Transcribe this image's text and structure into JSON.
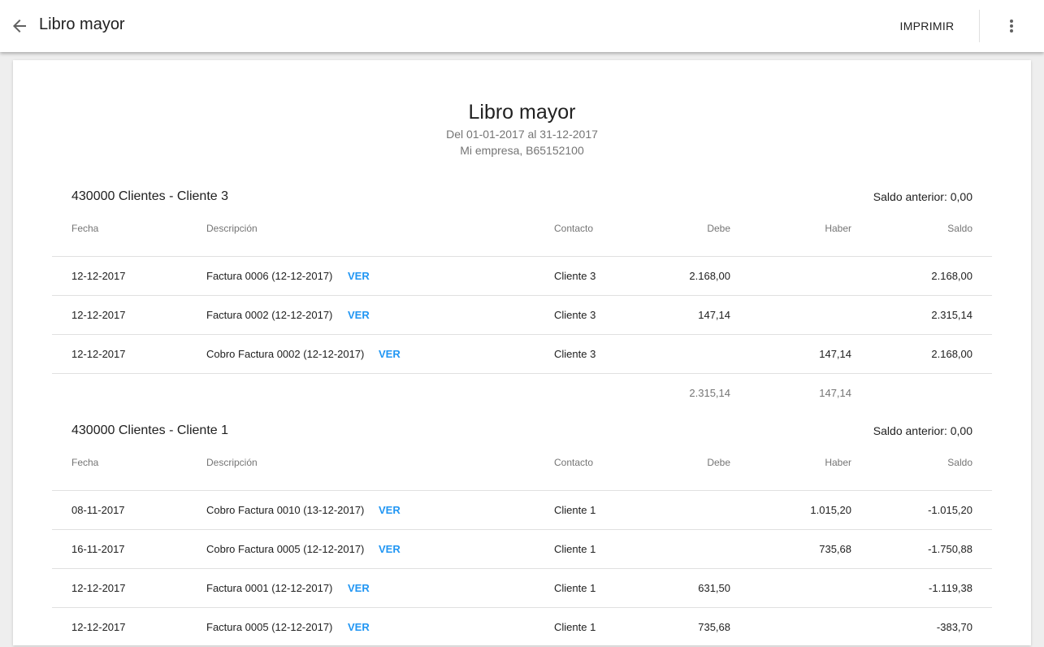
{
  "header": {
    "title": "Libro mayor",
    "print_label": "IMPRIMIR"
  },
  "report": {
    "title": "Libro mayor",
    "period": "Del 01-01-2017 al 31-12-2017",
    "company": "Mi empresa, B65152100"
  },
  "columns": {
    "fecha": "Fecha",
    "descripcion": "Descripción",
    "contacto": "Contacto",
    "debe": "Debe",
    "haber": "Haber",
    "saldo": "Saldo"
  },
  "sections": [
    {
      "account": "430000 Clientes - Cliente 3",
      "saldo_anterior": "Saldo anterior: 0,00",
      "rows": [
        {
          "fecha": "12-12-2017",
          "descripcion": "Factura 0006 (12-12-2017)",
          "link": "VER",
          "contacto": "Cliente 3",
          "debe": "2.168,00",
          "haber": "",
          "saldo": "2.168,00"
        },
        {
          "fecha": "12-12-2017",
          "descripcion": "Factura 0002 (12-12-2017)",
          "link": "VER",
          "contacto": "Cliente 3",
          "debe": "147,14",
          "haber": "",
          "saldo": "2.315,14"
        },
        {
          "fecha": "12-12-2017",
          "descripcion": "Cobro Factura 0002 (12-12-2017)",
          "link": "VER",
          "contacto": "Cliente 3",
          "debe": "",
          "haber": "147,14",
          "saldo": "2.168,00"
        }
      ],
      "totals": {
        "debe": "2.315,14",
        "haber": "147,14"
      }
    },
    {
      "account": "430000 Clientes - Cliente 1",
      "saldo_anterior": "Saldo anterior: 0,00",
      "rows": [
        {
          "fecha": "08-11-2017",
          "descripcion": "Cobro Factura 0010 (13-12-2017)",
          "link": "VER",
          "contacto": "Cliente 1",
          "debe": "",
          "haber": "1.015,20",
          "saldo": "-1.015,20"
        },
        {
          "fecha": "16-11-2017",
          "descripcion": "Cobro Factura 0005 (12-12-2017)",
          "link": "VER",
          "contacto": "Cliente 1",
          "debe": "",
          "haber": "735,68",
          "saldo": "-1.750,88"
        },
        {
          "fecha": "12-12-2017",
          "descripcion": "Factura 0001 (12-12-2017)",
          "link": "VER",
          "contacto": "Cliente 1",
          "debe": "631,50",
          "haber": "",
          "saldo": "-1.119,38"
        },
        {
          "fecha": "12-12-2017",
          "descripcion": "Factura 0005 (12-12-2017)",
          "link": "VER",
          "contacto": "Cliente 1",
          "debe": "735,68",
          "haber": "",
          "saldo": "-383,70"
        }
      ]
    }
  ]
}
